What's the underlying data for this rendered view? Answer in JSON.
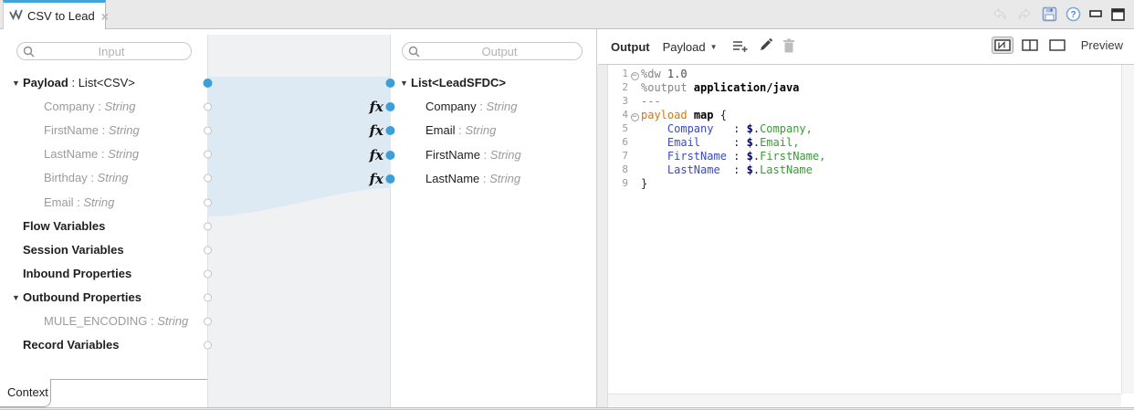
{
  "colors": {
    "tab_accent": "#42a4da",
    "port_blue": "#3b9fd9",
    "band_blue": "#dde9f3",
    "canvas_bg": "#f0f1f3",
    "code_key_blue": "#3b4bbf",
    "code_val_green": "#3a9b35",
    "code_keyword_orange": "#d4770a"
  },
  "tab_bar": {
    "active_tab": {
      "title": "CSV to Lead",
      "close_glyph": "×"
    }
  },
  "chrome_icons": [
    "undo",
    "redo",
    "save",
    "help",
    "minimize",
    "maximize"
  ],
  "input_panel": {
    "search_placeholder": "Input",
    "rows": [
      {
        "label": "Payload",
        "sep": " : ",
        "type": "List<CSV>",
        "level": 0,
        "arrow": true,
        "muted": false,
        "port": "filled"
      },
      {
        "label": "Company",
        "sep": " : ",
        "type": "String",
        "level": 1,
        "muted": true,
        "italic_type": true,
        "port": "hollow"
      },
      {
        "label": "FirstName",
        "sep": " : ",
        "type": "String",
        "level": 1,
        "muted": true,
        "italic_type": true,
        "port": "hollow"
      },
      {
        "label": "LastName",
        "sep": " : ",
        "type": "String",
        "level": 1,
        "muted": true,
        "italic_type": true,
        "port": "hollow"
      },
      {
        "label": "Birthday",
        "sep": " : ",
        "type": "String",
        "level": 1,
        "muted": true,
        "italic_type": true,
        "port": "hollow"
      },
      {
        "label": "Email",
        "sep": " : ",
        "type": "String",
        "level": 1,
        "muted": true,
        "italic_type": true,
        "port": "hollow"
      },
      {
        "label": "Flow Variables",
        "level": 0,
        "port": "hollow"
      },
      {
        "label": "Session Variables",
        "level": 0,
        "port": "hollow"
      },
      {
        "label": "Inbound Properties",
        "level": 0,
        "port": "hollow"
      },
      {
        "label": "Outbound Properties",
        "level": 0,
        "arrow": true,
        "port": "hollow"
      },
      {
        "label": "MULE_ENCODING",
        "sep": " : ",
        "type": "String",
        "level": 1,
        "muted": true,
        "italic_type": true,
        "port": "hollow"
      },
      {
        "label": "Record Variables",
        "level": 0,
        "port": "hollow"
      }
    ]
  },
  "output_panel": {
    "search_placeholder": "Output",
    "rows": [
      {
        "label": "List<LeadSFDC>",
        "level": 0,
        "arrow": true,
        "port": "filled"
      },
      {
        "label": "Company",
        "sep": " : ",
        "type": "String",
        "level": 1,
        "muted_type": true,
        "italic_type": true,
        "port": "filled",
        "fx": true
      },
      {
        "label": "Email",
        "sep": " : ",
        "type": "String",
        "level": 1,
        "muted_type": true,
        "italic_type": true,
        "port": "filled",
        "fx": true
      },
      {
        "label": "FirstName",
        "sep": " : ",
        "type": "String",
        "level": 1,
        "muted_type": true,
        "italic_type": true,
        "port": "filled",
        "fx": true
      },
      {
        "label": "LastName",
        "sep": " : ",
        "type": "String",
        "level": 1,
        "muted_type": true,
        "italic_type": true,
        "port": "filled",
        "fx": true
      }
    ]
  },
  "canvas": {
    "fx_label": "fx"
  },
  "code_panel": {
    "header": {
      "output_label": "Output",
      "target_label": "Payload",
      "preview_label": "Preview",
      "icons": [
        "add-transformation",
        "edit-pencil",
        "delete-trash"
      ],
      "view_toggles": [
        "view-all-panes",
        "view-two-panes",
        "view-single-pane"
      ]
    },
    "lines": [
      {
        "num": "1",
        "fold": true,
        "tokens": [
          [
            "%dw ",
            "dir"
          ],
          [
            "1.0",
            "ver"
          ]
        ]
      },
      {
        "num": "2",
        "fold": false,
        "tokens": [
          [
            "%output ",
            "dir"
          ],
          [
            "application/java",
            "strong"
          ]
        ]
      },
      {
        "num": "3",
        "fold": false,
        "tokens": [
          [
            "---",
            "dir"
          ]
        ]
      },
      {
        "num": "4",
        "fold": true,
        "tokens": [
          [
            "payload",
            "kw"
          ],
          [
            " ",
            "plain"
          ],
          [
            "map",
            "strong"
          ],
          [
            " {",
            "plain"
          ]
        ]
      },
      {
        "num": "5",
        "fold": false,
        "tokens": [
          [
            "    ",
            "plain"
          ],
          [
            "Company",
            "key"
          ],
          [
            "   : ",
            "plain"
          ],
          [
            "$",
            "dollar"
          ],
          [
            ".",
            "plain"
          ],
          [
            "Company,",
            "val"
          ]
        ]
      },
      {
        "num": "6",
        "fold": false,
        "tokens": [
          [
            "    ",
            "plain"
          ],
          [
            "Email",
            "key"
          ],
          [
            "     : ",
            "plain"
          ],
          [
            "$",
            "dollar"
          ],
          [
            ".",
            "plain"
          ],
          [
            "Email,",
            "val"
          ]
        ]
      },
      {
        "num": "7",
        "fold": false,
        "tokens": [
          [
            "    ",
            "plain"
          ],
          [
            "FirstName",
            "key"
          ],
          [
            " : ",
            "plain"
          ],
          [
            "$",
            "dollar"
          ],
          [
            ".",
            "plain"
          ],
          [
            "FirstName,",
            "val"
          ]
        ]
      },
      {
        "num": "8",
        "fold": false,
        "tokens": [
          [
            "    ",
            "plain"
          ],
          [
            "LastName",
            "key"
          ],
          [
            "  : ",
            "plain"
          ],
          [
            "$",
            "dollar"
          ],
          [
            ".",
            "plain"
          ],
          [
            "LastName",
            "val"
          ]
        ]
      },
      {
        "num": "9",
        "fold": false,
        "tokens": [
          [
            "}",
            "plain"
          ]
        ]
      }
    ]
  },
  "context_tab": {
    "label": "Context"
  }
}
